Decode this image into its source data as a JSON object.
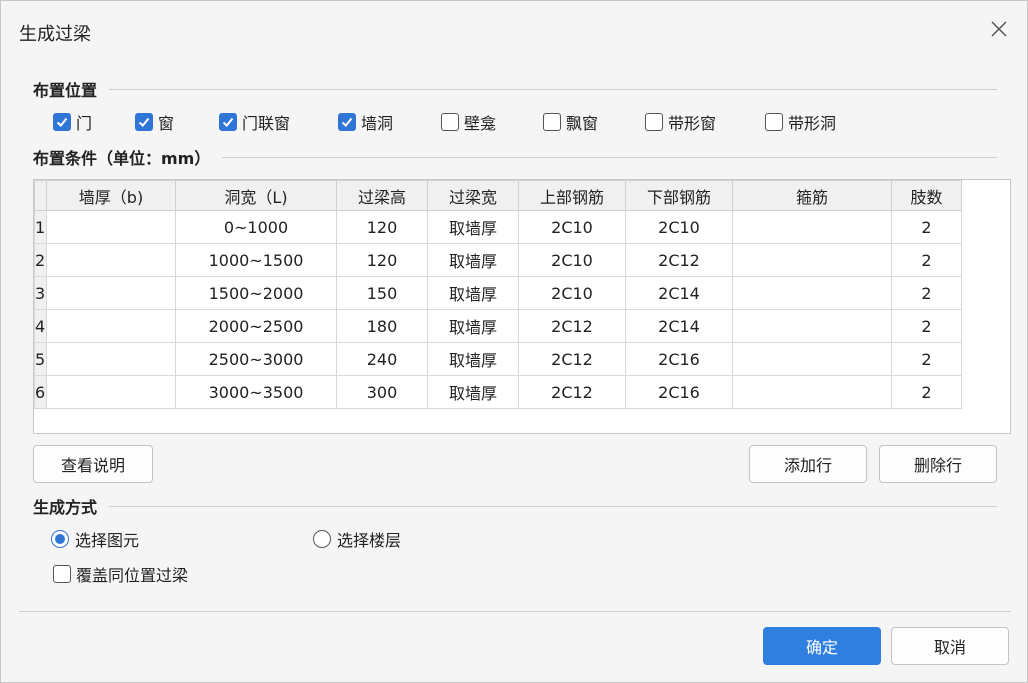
{
  "dialog": {
    "title": "生成过梁",
    "close_glyph": "×"
  },
  "placement": {
    "header": "布置位置",
    "options": [
      {
        "label": "门",
        "checked": true
      },
      {
        "label": "窗",
        "checked": true
      },
      {
        "label": "门联窗",
        "checked": true
      },
      {
        "label": "墙洞",
        "checked": true
      },
      {
        "label": "壁龛",
        "checked": false
      },
      {
        "label": "飘窗",
        "checked": false
      },
      {
        "label": "带形窗",
        "checked": false
      },
      {
        "label": "带形洞",
        "checked": false
      }
    ]
  },
  "conditions": {
    "header": "布置条件（单位：mm）",
    "columns": [
      "墙厚（b)",
      "洞宽（L)",
      "过梁高",
      "过梁宽",
      "上部钢筋",
      "下部钢筋",
      "箍筋",
      "肢数"
    ],
    "rows": [
      {
        "num": "1",
        "cells": [
          "",
          "0~1000",
          "120",
          "取墙厚",
          "2C10",
          "2C10",
          "",
          "2"
        ]
      },
      {
        "num": "2",
        "cells": [
          "",
          "1000~1500",
          "120",
          "取墙厚",
          "2C10",
          "2C12",
          "",
          "2"
        ]
      },
      {
        "num": "3",
        "cells": [
          "",
          "1500~2000",
          "150",
          "取墙厚",
          "2C10",
          "2C14",
          "",
          "2"
        ]
      },
      {
        "num": "4",
        "cells": [
          "",
          "2000~2500",
          "180",
          "取墙厚",
          "2C12",
          "2C14",
          "",
          "2"
        ]
      },
      {
        "num": "5",
        "cells": [
          "",
          "2500~3000",
          "240",
          "取墙厚",
          "2C12",
          "2C16",
          "",
          "2"
        ]
      },
      {
        "num": "6",
        "cells": [
          "",
          "3000~3500",
          "300",
          "取墙厚",
          "2C12",
          "2C16",
          "",
          "2"
        ]
      }
    ]
  },
  "buttons": {
    "view_help": "查看说明",
    "add_row": "添加行",
    "delete_row": "删除行",
    "ok": "确定",
    "cancel": "取消"
  },
  "generation": {
    "header": "生成方式",
    "radio_select_element": "选择图元",
    "radio_select_floor": "选择楼层",
    "selected": "选择图元",
    "overwrite_label": "覆盖同位置过梁",
    "overwrite_checked": false
  },
  "colors": {
    "accent": "#2f75d6",
    "primary_button": "#2f7fe0"
  }
}
